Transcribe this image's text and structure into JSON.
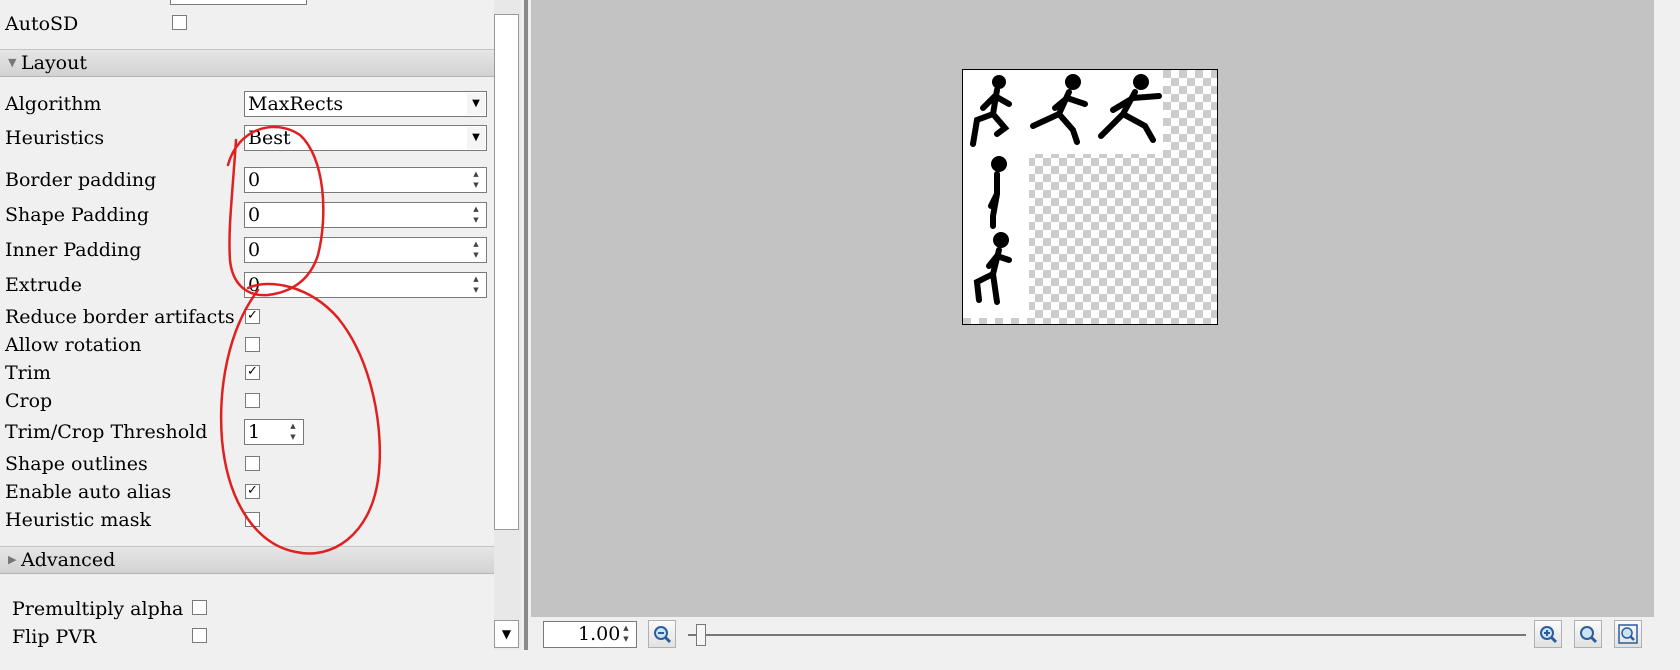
{
  "left_panel": {
    "autosd_label": "AutoSD",
    "layout_section": "Layout",
    "algorithm": {
      "label": "Algorithm",
      "value": "MaxRects"
    },
    "heuristics": {
      "label": "Heuristics",
      "value": "Best"
    },
    "border_padding": {
      "label": "Border padding",
      "value": "0"
    },
    "shape_padding": {
      "label": "Shape Padding",
      "value": "0"
    },
    "inner_padding": {
      "label": "Inner Padding",
      "value": "0"
    },
    "extrude": {
      "label": "Extrude",
      "value": "0"
    },
    "reduce_border_artifacts": {
      "label": "Reduce border artifacts",
      "checked": true
    },
    "allow_rotation": {
      "label": "Allow rotation",
      "checked": false
    },
    "trim": {
      "label": "Trim",
      "checked": true
    },
    "crop": {
      "label": "Crop",
      "checked": false
    },
    "trim_crop_threshold": {
      "label": "Trim/Crop Threshold",
      "value": "1"
    },
    "shape_outlines": {
      "label": "Shape outlines",
      "checked": false
    },
    "enable_auto_alias": {
      "label": "Enable auto alias",
      "checked": true
    },
    "heuristic_mask": {
      "label": "Heuristic mask",
      "checked": false
    },
    "advanced_section": "Advanced",
    "premultiply_alpha": {
      "label": "Premultiply alpha",
      "checked": false
    },
    "flip_pvr": {
      "label": "Flip PVR",
      "checked": false
    }
  },
  "preview_toolbar": {
    "zoom_value": "1.00",
    "zoom_slider_level": 0.01
  },
  "icons": {
    "zoom_out": "zoom-out-icon",
    "zoom_in": "zoom-in-icon",
    "zoom_fit": "zoom-fit-icon",
    "zoom_actual": "zoom-actual-icon"
  },
  "colors": {
    "canvas_bg": "#c3c3c3",
    "panel_bg": "#f0f0f0",
    "annotation_red": "#e02020",
    "checker_gray": "#cccccc"
  }
}
